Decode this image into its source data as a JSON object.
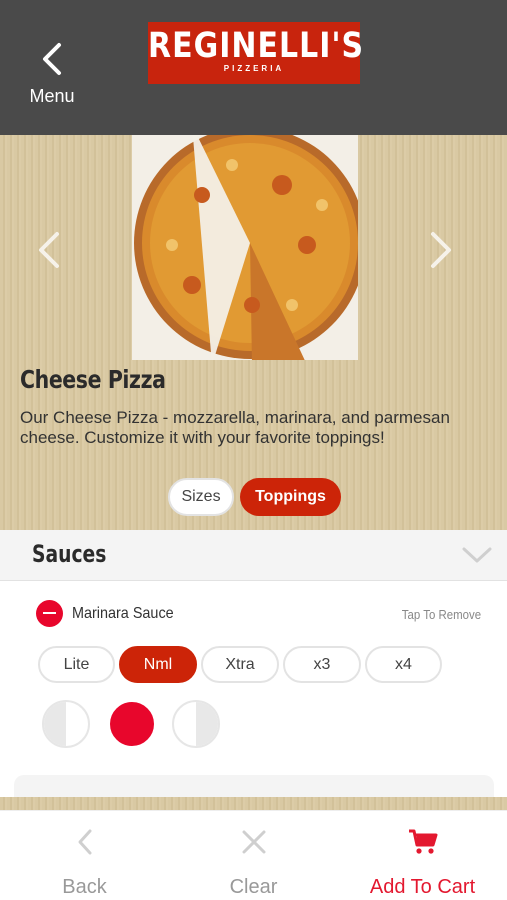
{
  "header": {
    "back_label": "Menu",
    "logo_text": "REGINELLI'S",
    "logo_subtext": "PIZZERIA",
    "brand_color": "#c8240d"
  },
  "item": {
    "title": "Cheese Pizza",
    "description": "Our Cheese Pizza - mozzarella, marinara, and parmesan cheese.  Customize it with your favorite toppings!",
    "tabs": [
      {
        "label": "Sizes",
        "active": false
      },
      {
        "label": "Toppings",
        "active": true
      }
    ]
  },
  "section": {
    "title": "Sauces"
  },
  "sauce": {
    "name": "Marinara Sauce",
    "hint": "Tap To Remove",
    "amounts": [
      {
        "label": "Lite",
        "active": false
      },
      {
        "label": "Nml",
        "active": true
      },
      {
        "label": "Xtra",
        "active": false
      },
      {
        "label": "x3",
        "active": false
      },
      {
        "label": "x4",
        "active": false
      }
    ],
    "portion_selected": "whole"
  },
  "bottom_bar": {
    "back_label": "Back",
    "clear_label": "Clear",
    "cart_label": "Add To Cart",
    "cart_color": "#e3182f"
  }
}
